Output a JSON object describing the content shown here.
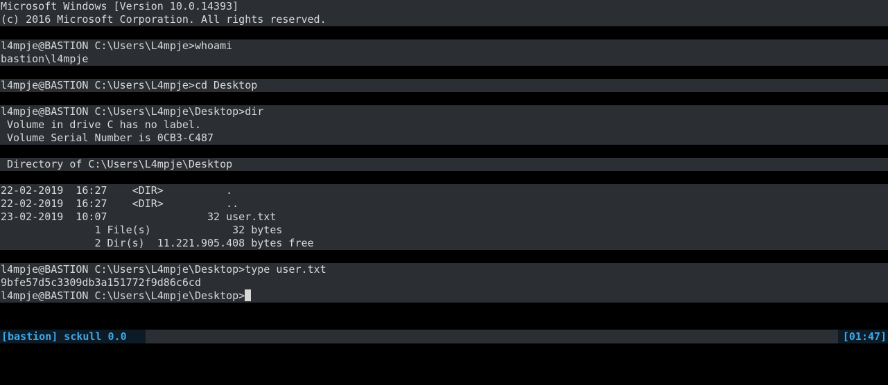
{
  "terminal": {
    "lines": [
      "Microsoft Windows [Version 10.0.14393]",
      "(c) 2016 Microsoft Corporation. All rights reserved.",
      "l4mpje@BASTION C:\\Users\\L4mpje>whoami",
      "bastion\\l4mpje",
      "l4mpje@BASTION C:\\Users\\L4mpje>cd Desktop",
      "l4mpje@BASTION C:\\Users\\L4mpje\\Desktop>dir",
      " Volume in drive C has no label.",
      " Volume Serial Number is 0CB3-C487",
      " Directory of C:\\Users\\L4mpje\\Desktop",
      "22-02-2019  16:27    <DIR>          .",
      "22-02-2019  16:27    <DIR>          ..",
      "23-02-2019  10:07                32 user.txt",
      "               1 File(s)             32 bytes",
      "               2 Dir(s)  11.221.905.408 bytes free",
      "l4mpje@BASTION C:\\Users\\L4mpje\\Desktop>type user.txt",
      "9bfe57d5c3309db3a151772f9d86c6cd",
      "l4mpje@BASTION C:\\Users\\L4mpje\\Desktop>"
    ]
  },
  "status": {
    "session": "[bastion] sckull 0.0",
    "time": "[01:47]"
  },
  "colors": {
    "block_bg": "#2b2f33",
    "status_accent": "#3fa7e8",
    "text": "#d8d8d8"
  }
}
